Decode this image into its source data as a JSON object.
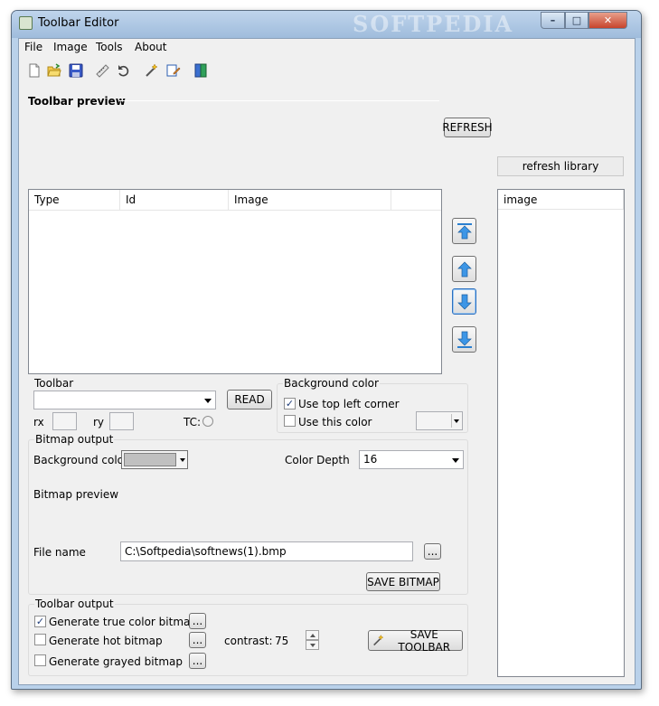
{
  "window": {
    "title": "Toolbar Editor",
    "watermark": "SOFTPEDIA",
    "min_glyph": "–",
    "max_glyph": "□",
    "close_glyph": "✕"
  },
  "menu": [
    "File",
    "Image",
    "Tools",
    "About"
  ],
  "toolbar_icons": [
    "new-file-icon",
    "open-folder-icon",
    "save-icon",
    "ruler-icon",
    "undo-icon",
    "magic-wand-icon",
    "edit-icon",
    "book-icon"
  ],
  "preview": {
    "title": "Toolbar preview",
    "refresh_label": "REFRESH"
  },
  "library": {
    "refresh_label": "refresh library",
    "column": "image"
  },
  "list": {
    "columns": [
      "Type",
      "Id",
      "Image"
    ]
  },
  "toolbar_group": {
    "title": "Toolbar",
    "read_label": "READ",
    "rx_label": "rx",
    "ry_label": "ry",
    "tc_label": "TC:"
  },
  "bg_color_group": {
    "title": "Background color",
    "use_top_left": "Use top left corner",
    "use_top_left_checked": true,
    "use_this_color": "Use this color",
    "use_this_color_checked": false
  },
  "bitmap_output": {
    "title": "Bitmap output",
    "bg_color_label": "Background color",
    "bg_color_value": "#c0c0c0",
    "color_depth_label": "Color Depth",
    "color_depth_value": "16",
    "preview_label": "Bitmap preview",
    "file_name_label": "File name",
    "file_name_value": "C:\\Softpedia\\softnews(1).bmp",
    "browse_label": "...",
    "save_label": "SAVE BITMAP"
  },
  "toolbar_output": {
    "title": "Toolbar output",
    "gen_true_color": "Generate true color bitmap",
    "gen_true_color_checked": true,
    "gen_hot": "Generate hot bitmap",
    "gen_hot_checked": false,
    "gen_grayed": "Generate grayed bitmap",
    "gen_grayed_checked": false,
    "browse_label": "...",
    "contrast_label": "contrast:",
    "contrast_value": "75",
    "save_label": "SAVE TOOLBAR"
  }
}
